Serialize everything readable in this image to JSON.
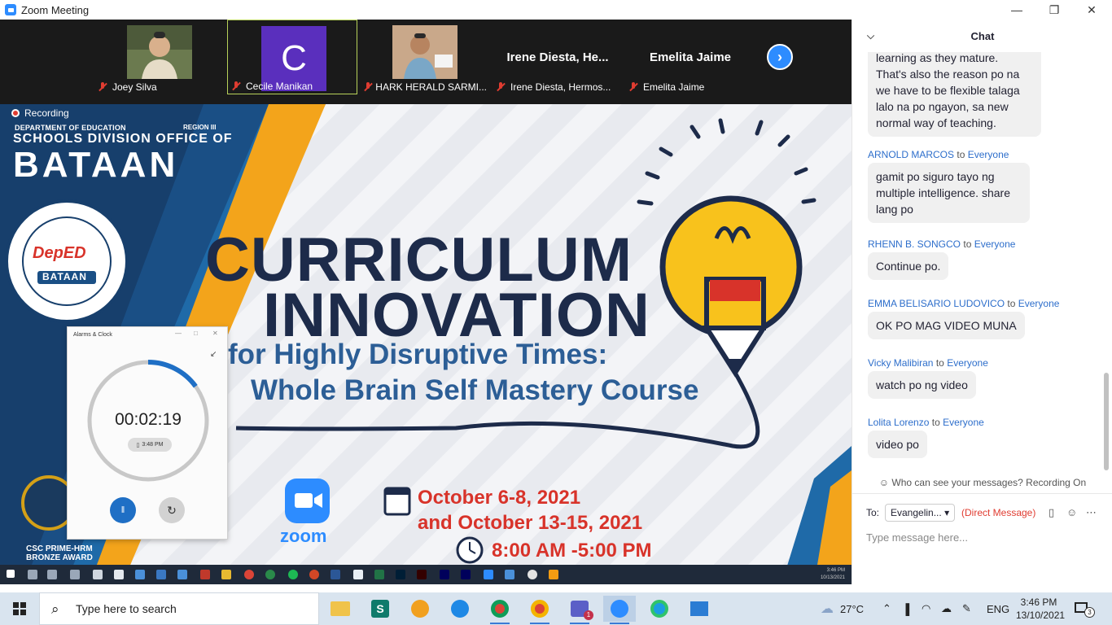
{
  "window": {
    "title": "Zoom Meeting",
    "controls": [
      "minimize-icon",
      "restore-icon",
      "close-icon"
    ]
  },
  "participants": [
    {
      "name": "Joey Silva",
      "tile": "photo"
    },
    {
      "name": "Cecile Manikan",
      "tile": "avatar",
      "initial": "C",
      "active": true
    },
    {
      "name": "HARK HERALD SARMI...",
      "tile": "photo"
    },
    {
      "name": "Irene Diesta, Hermos...",
      "tile": "name",
      "display": "Irene  Diesta,  He..."
    },
    {
      "name": "Emelita Jaime",
      "tile": "name",
      "display": "Emelita Jaime"
    }
  ],
  "share": {
    "recording": "Recording",
    "org_line": "DEPARTMENT OF EDUCATION",
    "region": "REGION III",
    "sdo": "SCHOOLS DIVISION OFFICE OF",
    "division": "BATAAN",
    "title_line1": "CURRICULUM",
    "title_line2": "INNOVATION",
    "subtitle_line1": "for Highly Disruptive Times:",
    "subtitle_line2": "Whole Brain Self Mastery Course",
    "date_line1": "October 6-8, 2021",
    "date_line2": "and October 13-15, 2021",
    "time": "8:00 AM -5:00 PM",
    "zoom_label": "zoom",
    "award_line1": "CSC PRIME-HRM",
    "award_line2": "BRONZE AWARD",
    "seal_text": "DepED",
    "seal_ribbon": "BATAAN",
    "inner_clock": {
      "time": "3:46 PM",
      "date": "10/13/2021"
    },
    "alarm_window": {
      "title": "Alarms & Clock",
      "timer": "00:02:19",
      "end_time": "3:48 PM",
      "progress": 0.15
    }
  },
  "chat": {
    "title": "Chat",
    "messages": [
      {
        "sender": "",
        "to": "",
        "text_lines": [
          "learning as they mature.",
          "That's also the reason po na",
          "we have to be flexible talaga",
          "lalo na po ngayon, sa new",
          "normal way of teaching."
        ]
      },
      {
        "sender": "ARNOLD MARCOS",
        "to": "Everyone",
        "text_lines": [
          "gamit po siguro tayo ng",
          "multiple intelligence. share",
          "lang po"
        ]
      },
      {
        "sender": "RHENN B. SONGCO",
        "to": "Everyone",
        "text_lines": [
          "Continue po."
        ]
      },
      {
        "sender": "EMMA BELISARIO LUDOVICO",
        "to": "Everyone",
        "text_lines": [
          "OK PO MAG VIDEO MUNA"
        ]
      },
      {
        "sender": "Vicky Malibiran",
        "to": "Everyone",
        "text_lines": [
          "watch po ng video"
        ]
      },
      {
        "sender": "Lolita Lorenzo",
        "to": "Everyone",
        "text_lines": [
          "video po"
        ]
      }
    ],
    "to_word": "to",
    "visibility_notice": "Who can see your messages? Recording On",
    "to_label": "To:",
    "recipient": "Evangelin...",
    "direct_message": "(Direct Message)",
    "input_placeholder": "Type message here..."
  },
  "taskbar": {
    "search_placeholder": "Type here to search",
    "weather": "27°C",
    "language": "ENG",
    "time": "3:46 PM",
    "date": "13/10/2021",
    "notification_count": "3",
    "teams_badge": "1"
  }
}
